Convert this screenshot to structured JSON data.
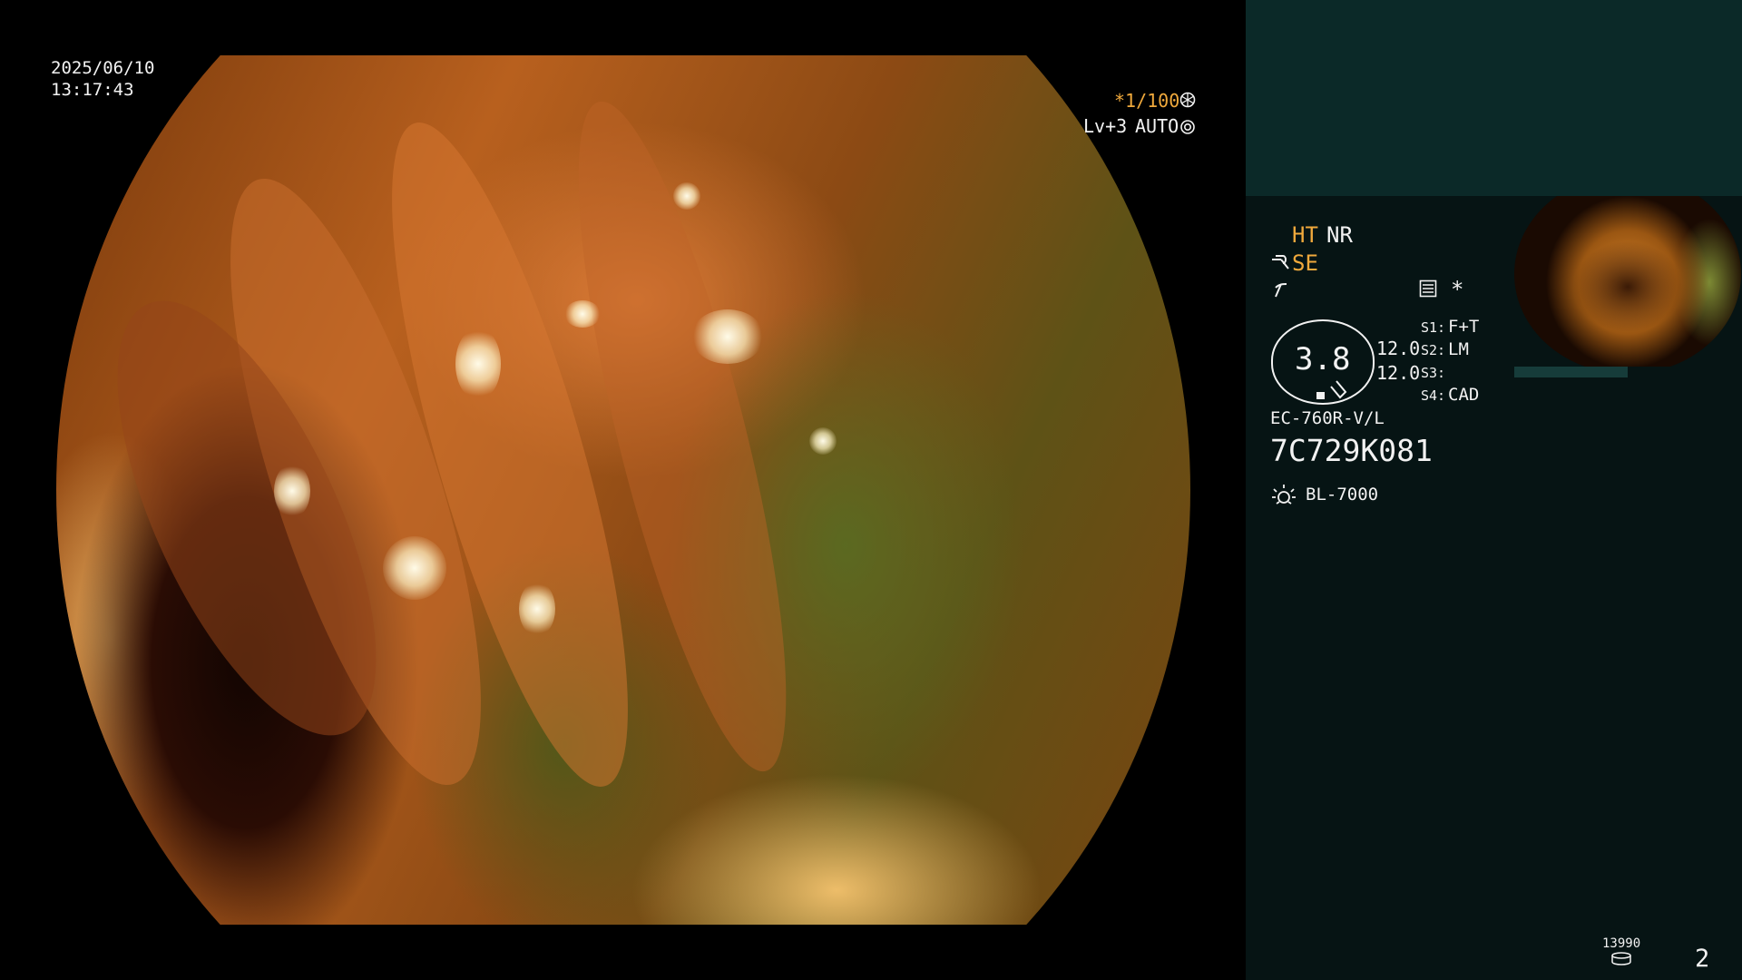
{
  "osd": {
    "date": "2025/06/10",
    "time": "13:17:43",
    "shutter": "*1/100",
    "level": "Lv+3",
    "auto": "AUTO"
  },
  "panel": {
    "ht": "HT",
    "nr": "NR",
    "se": "SE",
    "s1_label": "S1:",
    "s1_value": "F+T",
    "s2_label": "S2:",
    "s2_value": "LM",
    "s3_label": "S3:",
    "s4_label": "S4:",
    "s4_value": "CAD",
    "scope_value": "3.8",
    "scope_dim_1": "12.0",
    "scope_dim_2": "12.0",
    "scope_model": "EC-760R-V/L",
    "scope_serial": "7C729K081",
    "light_source": "BL-7000",
    "image_count": "13990",
    "page_number": "2"
  },
  "icons": {
    "shutter": "aperture-icon",
    "auto": "gear-icon",
    "se": "magnifier-icon",
    "wave": "hook-icon",
    "memory": "memory-card-icon",
    "star": "asterisk-icon",
    "light": "lamp-icon",
    "storage": "disk-stack-icon"
  },
  "colors": {
    "accent": "#f0a93c",
    "text": "#f2f2f2",
    "panel_top": "#0b2928",
    "panel_bottom": "#061414"
  }
}
